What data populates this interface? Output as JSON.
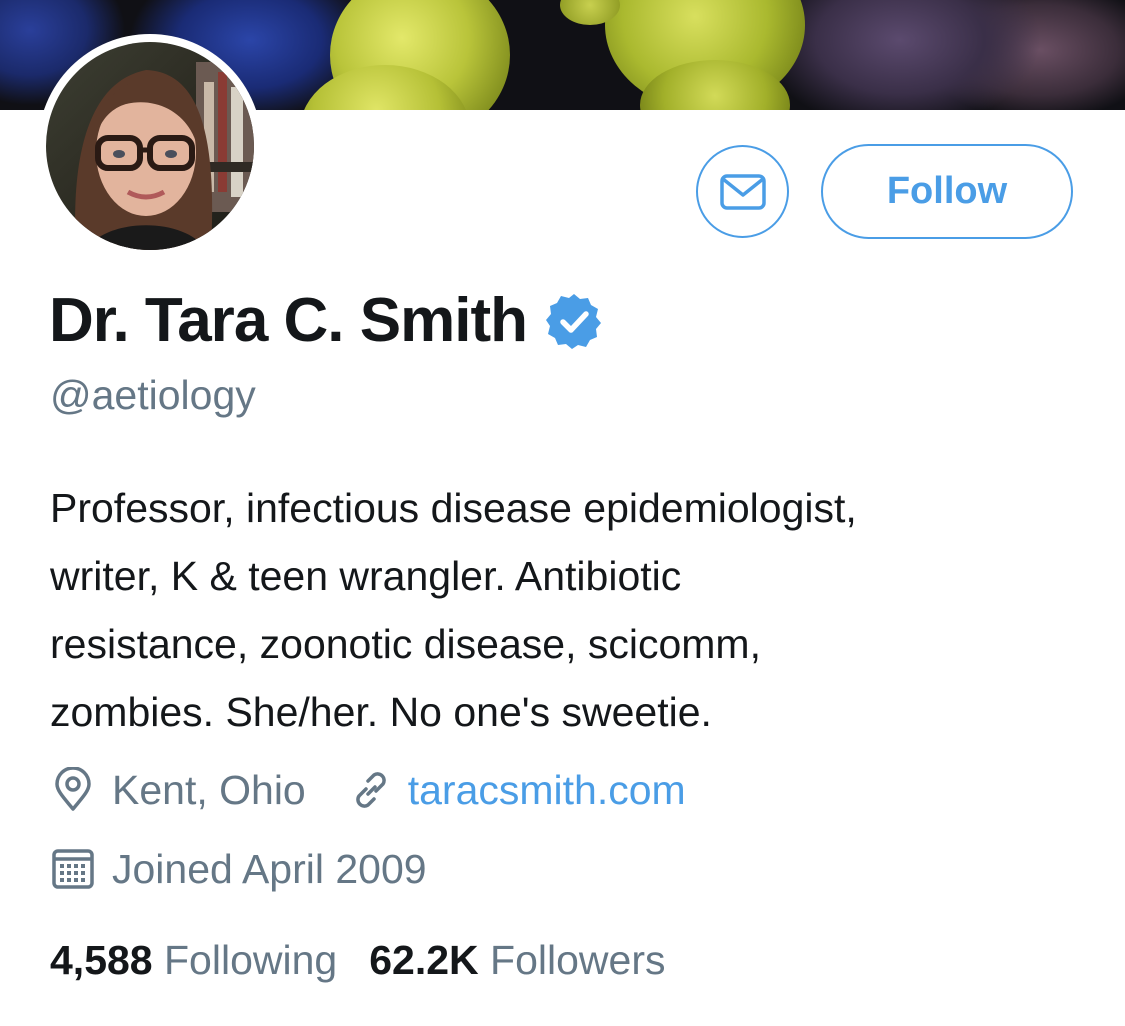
{
  "profile": {
    "name": "Dr. Tara C. Smith",
    "handle": "@aetiology",
    "bio_lines": [
      "Professor, infectious disease epidemiologist,",
      "writer, K & teen wrangler. Antibiotic",
      "resistance, zoonotic disease, scicomm,",
      "zombies. She/her. No one's sweetie."
    ],
    "location": "Kent, Ohio",
    "website": "taracsmith.com",
    "joined": "Joined April 2009",
    "following_count": "4,588",
    "following_label": "Following",
    "followers_count": "62.2K",
    "followers_label": "Followers"
  },
  "actions": {
    "follow_label": "Follow"
  },
  "icons": {
    "message": "envelope-icon",
    "verified": "verified-badge-icon",
    "location": "location-pin-icon",
    "website": "link-icon",
    "joined": "calendar-icon"
  },
  "colors": {
    "accent": "#4a9de6",
    "text": "#14171a",
    "secondary_text": "#657786",
    "verified": "#4a9de6"
  }
}
